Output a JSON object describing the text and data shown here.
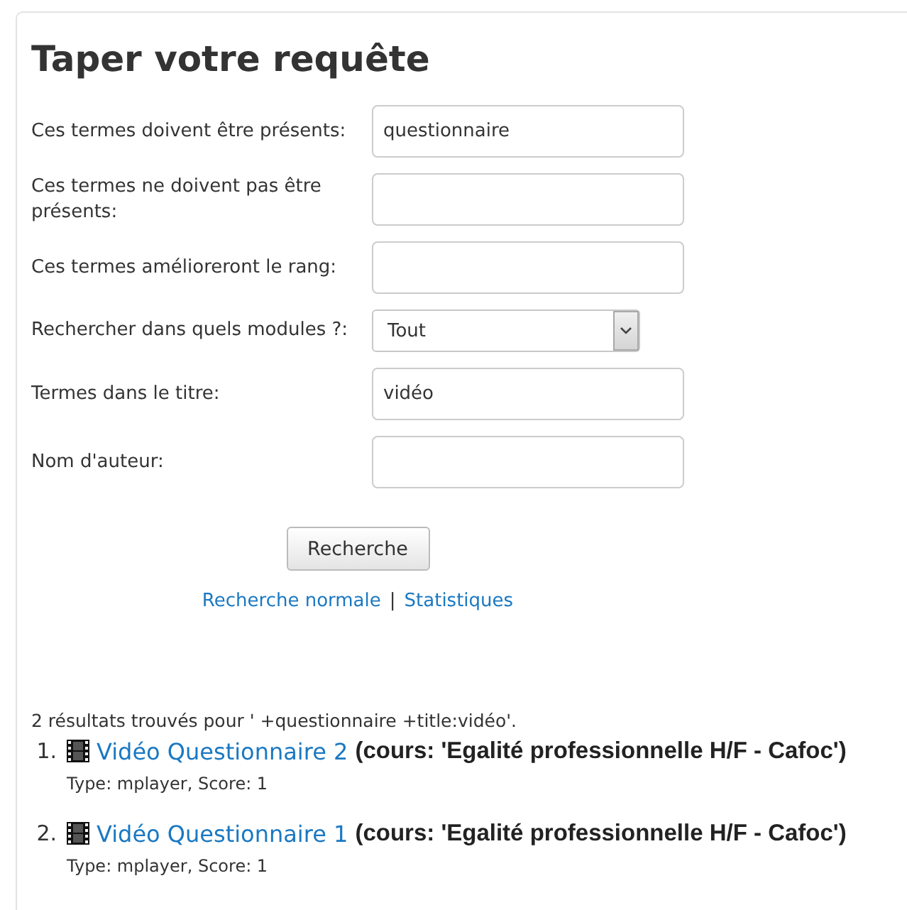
{
  "heading": "Taper votre requête",
  "fields": [
    {
      "kind": "text",
      "label": "Ces termes doivent être présents:",
      "value": "questionnaire"
    },
    {
      "kind": "text",
      "label": "Ces termes ne doivent pas être présents:"
    },
    {
      "kind": "text",
      "label": "Ces termes amélioreront le rang:"
    },
    {
      "kind": "select",
      "label": "Rechercher dans quels modules ?:",
      "value": "Tout"
    },
    {
      "kind": "text",
      "label": "Termes dans le titre:",
      "value": "vidéo"
    },
    {
      "kind": "text",
      "label": "Nom d'auteur:"
    }
  ],
  "submit_button": "Recherche",
  "links": {
    "items": [
      "Recherche normale",
      "Statistiques"
    ],
    "separator": "|"
  },
  "results": {
    "summary": "2 résultats trouvés pour ' +questionnaire +title:vidéo'.",
    "items": [
      {
        "number": "1.",
        "title": "Vidéo Questionnaire 2",
        "course": "(cours: 'Egalité professionnelle H/F - Cafoc')",
        "details": "Type: mplayer, Score: 1"
      },
      {
        "number": "2.",
        "title": "Vidéo Questionnaire 1",
        "course": "(cours: 'Egalité professionnelle H/F - Cafoc')",
        "details": "Type: mplayer, Score: 1"
      }
    ]
  }
}
